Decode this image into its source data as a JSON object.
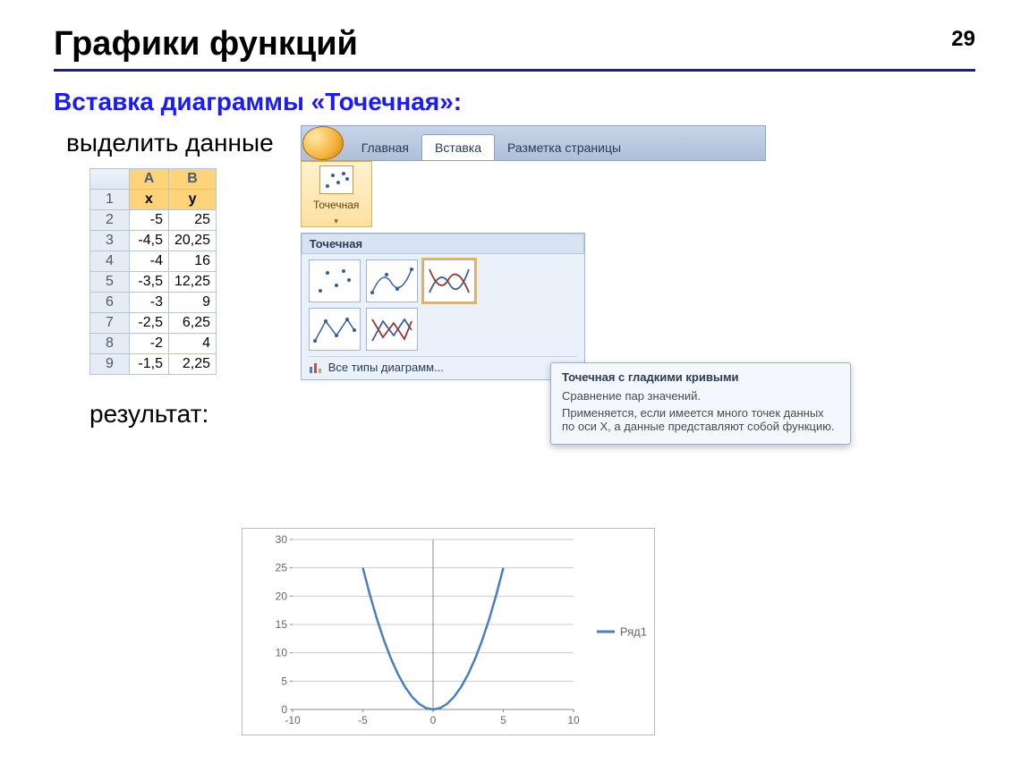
{
  "page_number": "29",
  "title": "Графики функций",
  "subtitle": "Вставка диаграммы «Точечная»:",
  "step1_label": "выделить данные",
  "result_label": "результат:",
  "sheet": {
    "col_letters": [
      "A",
      "B"
    ],
    "headers": [
      "x",
      "y"
    ],
    "rows": [
      {
        "n": "2",
        "a": "-5",
        "b": "25"
      },
      {
        "n": "3",
        "a": "-4,5",
        "b": "20,25"
      },
      {
        "n": "4",
        "a": "-4",
        "b": "16"
      },
      {
        "n": "5",
        "a": "-3,5",
        "b": "12,25"
      },
      {
        "n": "6",
        "a": "-3",
        "b": "9"
      },
      {
        "n": "7",
        "a": "-2,5",
        "b": "6,25"
      },
      {
        "n": "8",
        "a": "-2",
        "b": "4"
      },
      {
        "n": "9",
        "a": "-1,5",
        "b": "2,25"
      }
    ]
  },
  "ribbon": {
    "tabs": [
      "Главная",
      "Вставка",
      "Разметка страницы"
    ],
    "active_tab": 1,
    "chunk_label": "Точечная",
    "gallery_title": "Точечная",
    "all_types": "Все типы диаграмм..."
  },
  "tooltip": {
    "title": "Точечная с гладкими кривыми",
    "line1": "Сравнение пар значений.",
    "line2": "Применяется, если имеется много точек данных по оси X, а данные представляют собой функцию."
  },
  "chart_data": {
    "type": "line",
    "title": "",
    "xlabel": "",
    "ylabel": "",
    "xlim": [
      -10,
      10
    ],
    "ylim": [
      0,
      30
    ],
    "x_ticks": [
      -10,
      -5,
      0,
      5,
      10
    ],
    "y_ticks": [
      0,
      5,
      10,
      15,
      20,
      25,
      30
    ],
    "x": [
      -5,
      -4.5,
      -4,
      -3.5,
      -3,
      -2.5,
      -2,
      -1.5,
      -1,
      -0.5,
      0,
      0.5,
      1,
      1.5,
      2,
      2.5,
      3,
      3.5,
      4,
      4.5,
      5
    ],
    "values": [
      25,
      20.25,
      16,
      12.25,
      9,
      6.25,
      4,
      2.25,
      1,
      0.25,
      0,
      0.25,
      1,
      2.25,
      4,
      6.25,
      9,
      12.25,
      16,
      20.25,
      25
    ],
    "series_name": "Ряд1"
  }
}
